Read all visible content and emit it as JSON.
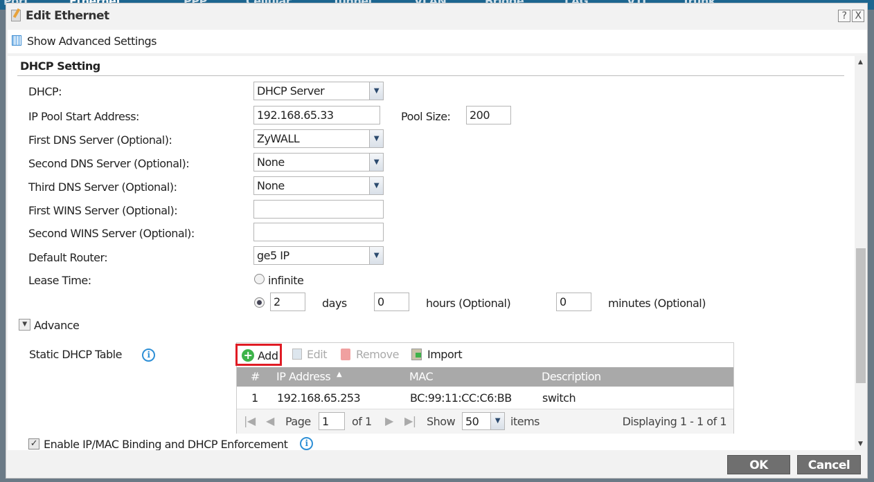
{
  "background_tabs": [
    "Port",
    "Ethernet",
    "PPP",
    "Cellular",
    "Tunnel",
    "VLAN",
    "Bridge",
    "LAG",
    "VTI",
    "Trunk"
  ],
  "dialog": {
    "title": "Edit Ethernet",
    "help": "?",
    "close": "X",
    "show_advanced": "Show Advanced Settings"
  },
  "section": {
    "title": "DHCP Setting"
  },
  "form": {
    "dhcp_label": "DHCP:",
    "dhcp_value": "DHCP Server",
    "pool_start_label": "IP Pool Start Address:",
    "pool_start_value": "192.168.65.33",
    "pool_size_label": "Pool Size:",
    "pool_size_value": "200",
    "dns1_label": "First DNS Server (Optional):",
    "dns1_value": "ZyWALL",
    "dns2_label": "Second DNS Server (Optional):",
    "dns2_value": "None",
    "dns3_label": "Third DNS Server (Optional):",
    "dns3_value": "None",
    "wins1_label": "First WINS Server (Optional):",
    "wins1_value": "",
    "wins2_label": "Second WINS Server (Optional):",
    "wins2_value": "",
    "router_label": "Default Router:",
    "router_value": "ge5 IP",
    "lease_label": "Lease Time:",
    "infinite_label": "infinite",
    "days_value": "2",
    "days_label": "days",
    "hours_value": "0",
    "hours_label": "hours (Optional)",
    "minutes_value": "0",
    "minutes_label": "minutes (Optional)",
    "lease_selected": "days"
  },
  "advance": {
    "label": "Advance",
    "static_table_label": "Static DHCP Table"
  },
  "toolbar": {
    "add": "Add",
    "edit": "Edit",
    "remove": "Remove",
    "import": "Import"
  },
  "table": {
    "columns": [
      "#",
      "IP Address",
      "MAC",
      "Description"
    ],
    "rows": [
      {
        "num": "1",
        "ip": "192.168.65.253",
        "mac": "BC:99:11:CC:C6:BB",
        "desc": "switch"
      }
    ]
  },
  "pager": {
    "page_label": "Page",
    "page_value": "1",
    "of": "of 1",
    "show": "Show",
    "show_value": "50",
    "items": "items",
    "displaying": "Displaying 1 - 1 of 1"
  },
  "binding": {
    "label": "Enable IP/MAC Binding and DHCP Enforcement",
    "checked": true
  },
  "footer": {
    "ok": "OK",
    "cancel": "Cancel"
  }
}
